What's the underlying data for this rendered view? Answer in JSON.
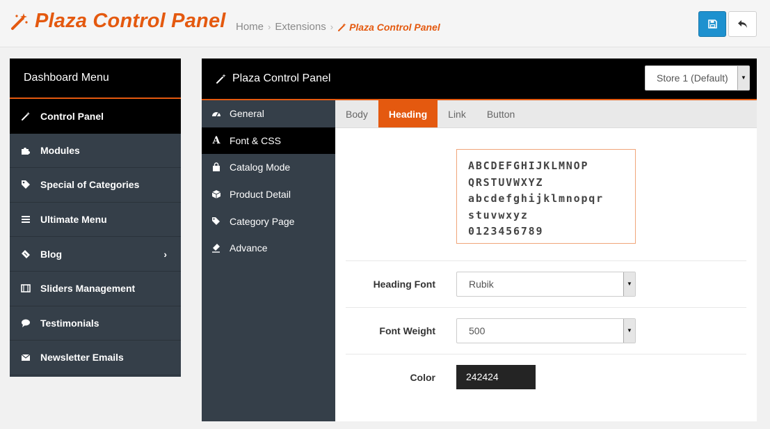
{
  "header": {
    "title": "Plaza Control Panel",
    "breadcrumb": [
      "Home",
      "Extensions",
      "Plaza Control Panel"
    ],
    "save_icon": "floppy-disk-icon",
    "back_icon": "reply-arrow-icon",
    "accent": "#e4590f"
  },
  "dashboard": {
    "title": "Dashboard Menu",
    "items": [
      {
        "label": "Control Panel",
        "icon": "magic-wand-icon"
      },
      {
        "label": "Modules",
        "icon": "puzzle-icon"
      },
      {
        "label": "Special of Categories",
        "icon": "tag-icon"
      },
      {
        "label": "Ultimate Menu",
        "icon": "bars-icon"
      },
      {
        "label": "Blog",
        "icon": "ticket-icon"
      },
      {
        "label": "Sliders Management",
        "icon": "film-icon"
      },
      {
        "label": "Testimonials",
        "icon": "comment-icon"
      },
      {
        "label": "Newsletter Emails",
        "icon": "envelope-icon"
      }
    ]
  },
  "panel": {
    "title": "Plaza Control Panel",
    "store": "Store 1 (Default)",
    "sidebar": [
      {
        "label": "General",
        "icon": "dashboard-icon"
      },
      {
        "label": "Font & CSS",
        "icon": "font-icon"
      },
      {
        "label": "Catalog Mode",
        "icon": "shopping-bag-icon"
      },
      {
        "label": "Product Detail",
        "icon": "cube-icon"
      },
      {
        "label": "Category Page",
        "icon": "tags-icon"
      },
      {
        "label": "Advance",
        "icon": "eraser-icon"
      }
    ],
    "tabs": [
      "Body",
      "Heading",
      "Link",
      "Button"
    ],
    "preview_lines": [
      "ABCDEFGHIJKLMNOP",
      "QRSTUVWXYZ",
      "abcdefghijklmnopqr",
      "stuvwxyz",
      "0123456789"
    ],
    "fields": {
      "heading_font_label": "Heading Font",
      "heading_font_value": "Rubik",
      "font_weight_label": "Font Weight",
      "font_weight_value": "500",
      "color_label": "Color",
      "color_value": "242424"
    }
  }
}
